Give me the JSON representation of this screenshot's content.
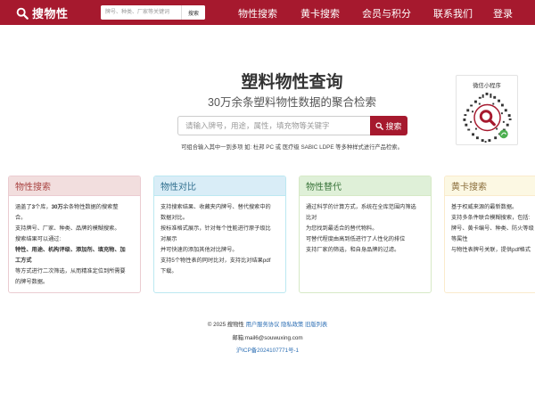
{
  "header": {
    "logo_text": "搜物性",
    "search_placeholder": "牌号、种类、厂家等关键词",
    "search_button": "搜索",
    "nav": [
      "物性搜索",
      "黄卡搜索",
      "会员与积分",
      "联系我们",
      "登录"
    ]
  },
  "hero": {
    "title": "塑料物性查询",
    "subtitle": "30万余条塑料物性数据的聚合检索",
    "search_placeholder": "请输入牌号，用途，属性，填充物等关键字",
    "search_button": "搜索",
    "hint": "可组合输入其中一到多项 如: 杜邦 PC 或 医疗级 SABIC LDPE 等多种样式进行产品检索。"
  },
  "mini_program": {
    "title": "微信小程序"
  },
  "cards": [
    {
      "title": "物性搜索",
      "lines": [
        {
          "segments": [
            {
              "t": "涵盖了"
            },
            {
              "t": "3",
              "b": true
            },
            {
              "t": "个库，"
            },
            {
              "t": "30万",
              "b": true
            },
            {
              "t": "余条物性数据的搜索整"
            }
          ]
        },
        {
          "segments": [
            {
              "t": "合。"
            }
          ]
        },
        {
          "segments": [
            {
              "t": "支持牌号、厂家、种类、品牌的模糊搜索。"
            }
          ]
        },
        {
          "segments": [
            {
              "t": "搜索结果可以通过:"
            }
          ]
        },
        {
          "segments": [
            {
              "t": "特性、用途、机构评级、添加剂、填充物、加",
              "b": true
            }
          ]
        },
        {
          "segments": [
            {
              "t": "工方式",
              "b": true
            }
          ]
        },
        {
          "segments": [
            {
              "t": "等方式进行二次筛选，从而精准定位到所需要"
            }
          ]
        },
        {
          "segments": [
            {
              "t": "的牌号数据。"
            }
          ]
        }
      ]
    },
    {
      "title": "物性对比",
      "lines": [
        {
          "segments": [
            {
              "t": "支持搜索结果、收藏夹内牌号、替代搜索中的"
            }
          ]
        },
        {
          "segments": [
            {
              "t": "数据对比。"
            }
          ]
        },
        {
          "segments": [
            {
              "t": "按标准格式展示，针对每个性能进行原子级比"
            }
          ]
        },
        {
          "segments": [
            {
              "t": "对展示"
            }
          ]
        },
        {
          "segments": [
            {
              "t": "并可快速的添加其他对比牌号。"
            }
          ]
        },
        {
          "segments": [
            {
              "t": "支持5个物性表的同时比对，支持比对结果pdf"
            }
          ]
        },
        {
          "segments": [
            {
              "t": "下载。"
            }
          ]
        }
      ]
    },
    {
      "title": "物性替代",
      "lines": [
        {
          "segments": [
            {
              "t": "通过科学的计算方式，系统在全库范围内筛选"
            }
          ]
        },
        {
          "segments": [
            {
              "t": "比对"
            }
          ]
        },
        {
          "segments": [
            {
              "t": "为您找到最适合的替代物料。"
            }
          ]
        },
        {
          "segments": [
            {
              "t": "可替代程度由高到低进行了人性化的排位"
            }
          ]
        },
        {
          "segments": [
            {
              "t": "支持厂家的筛选，和自身品牌的过滤。"
            }
          ]
        }
      ]
    },
    {
      "title": "黄卡搜索",
      "lines": [
        {
          "segments": [
            {
              "t": "基于权威来源的最新数据。"
            }
          ]
        },
        {
          "segments": [
            {
              "t": "支持多条件联合模糊搜索，包括:"
            }
          ]
        },
        {
          "segments": [
            {
              "t": "牌号、黄卡编号、种类、防火等级"
            }
          ]
        },
        {
          "segments": [
            {
              "t": "等属性"
            }
          ]
        },
        {
          "segments": [
            {
              "t": "与物性表牌号关联，提供pdf格式"
            }
          ]
        }
      ]
    }
  ],
  "footer": {
    "copyright": "© 2025 搜物性",
    "links": [
      "用户服务协议",
      "隐私政策",
      "旧版列表"
    ],
    "email": "邮箱:mail6@souwuxing.com",
    "icp": "沪ICP备2024107771号-1"
  },
  "colors": {
    "brand": "#a6192e"
  }
}
